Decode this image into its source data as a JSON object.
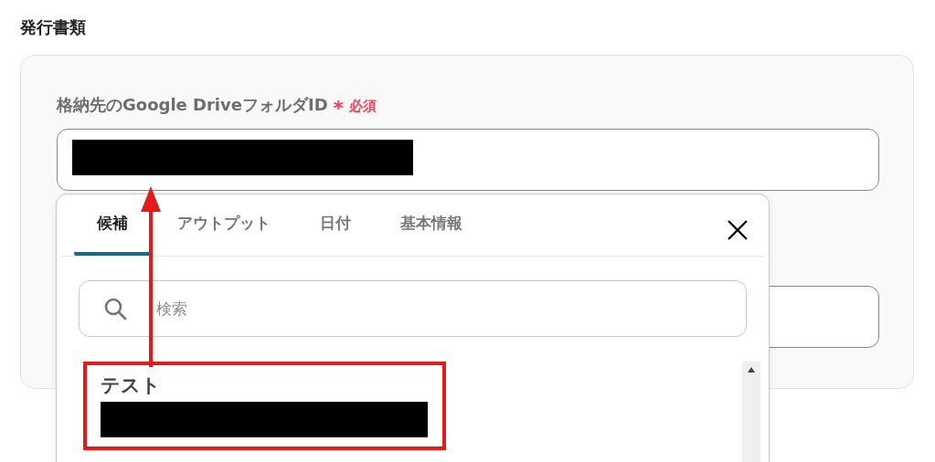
{
  "section_title": "発行書類",
  "fields": [
    {
      "label": "格納先のGoogle DriveフォルダID",
      "required_mark": "*",
      "required_label": "必須",
      "kind": "input",
      "value_redacted": true
    },
    {
      "kind": "input"
    }
  ],
  "popup": {
    "tabs": [
      {
        "label": "候補",
        "selected": true
      },
      {
        "label": "アウトプット",
        "selected": false
      },
      {
        "label": "日付",
        "selected": false
      },
      {
        "label": "基本情報",
        "selected": false
      }
    ],
    "search": {
      "placeholder": "検索"
    },
    "items": [
      {
        "label": "テスト",
        "value_redacted": true,
        "highlighted": true
      }
    ]
  }
}
